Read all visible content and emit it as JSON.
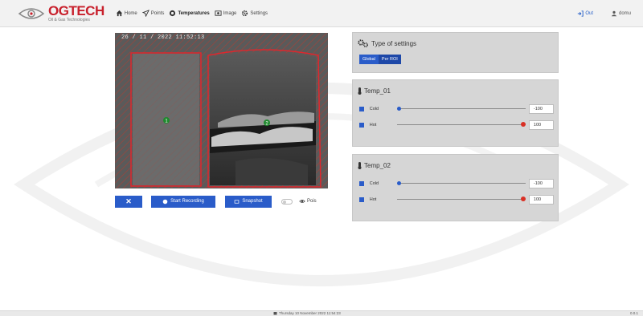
{
  "app": {
    "brand": "OGTECH",
    "tagline": "Oil & Gas Technologies"
  },
  "nav": {
    "items": [
      {
        "label": "Home",
        "icon": "home-icon"
      },
      {
        "label": "Points",
        "icon": "send-icon"
      },
      {
        "label": "Temperatures",
        "icon": "eye-icon",
        "active": true
      },
      {
        "label": "Image",
        "icon": "image-icon"
      },
      {
        "label": "Settings",
        "icon": "gear-icon"
      }
    ],
    "logout_label": "Out",
    "user_label": "domu"
  },
  "camera": {
    "timestamp": "26 / 11 / 2022 11:52:13",
    "roi_1_label": "1",
    "roi_2_label": "2"
  },
  "camera_controls": {
    "close_label": "✕",
    "record_label": "Start Recording",
    "snapshot_label": "Snapshot",
    "pois_label": "Pois"
  },
  "settings": {
    "title": "Type of settings",
    "modes": [
      "Global",
      "Per ROI"
    ],
    "active_mode": "Per ROI"
  },
  "rois": [
    {
      "title": "Temp_01",
      "cold": {
        "label": "Cold",
        "value": "-100",
        "color": "#2a5cc9"
      },
      "hot": {
        "label": "Hot",
        "value": "100",
        "color": "#d93025"
      }
    },
    {
      "title": "Temp_02",
      "cold": {
        "label": "Cold",
        "value": "-100",
        "color": "#2a5cc9"
      },
      "hot": {
        "label": "Hot",
        "value": "100",
        "color": "#d93025"
      }
    }
  ],
  "footer": {
    "datetime": "Thursday 10 November 2022 11:54:23",
    "version": "0.0.1"
  },
  "colors": {
    "accent": "#2a5cc9",
    "brand": "#c8202c",
    "roi_outline": "#e0262d"
  }
}
